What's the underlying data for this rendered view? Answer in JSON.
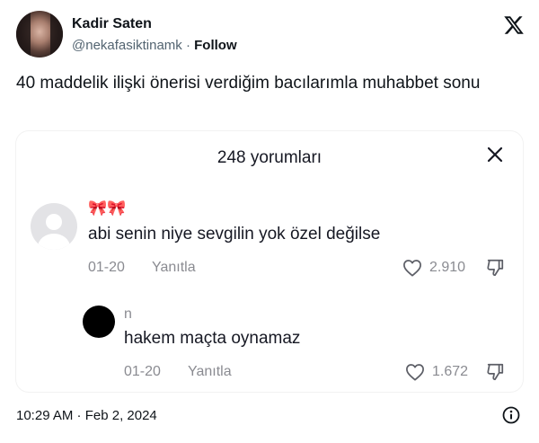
{
  "tweet": {
    "author": {
      "display_name": "Kadir Saten",
      "handle": "@nekafasiktinamk",
      "separator": "·",
      "follow_label": "Follow"
    },
    "text": "40 maddelik ilişki önerisi verdiğim bacılarımla muhabbet sonu",
    "timestamp": "10:29 AM · Feb 2, 2024"
  },
  "comments_panel": {
    "title": "248 yorumları",
    "comments": [
      {
        "username": "🎀🎀",
        "text": "abi senin niye sevgilin yok özel değilse",
        "date": "01-20",
        "reply_label": "Yanıtla",
        "likes": "2.910"
      },
      {
        "username": "n",
        "text": "hakem maçta oynamaz",
        "date": "01-20",
        "reply_label": "Yanıtla",
        "likes": "1.672"
      }
    ]
  },
  "icons": {
    "brand": "x-logo-icon",
    "close": "close-icon",
    "like": "heart-icon",
    "dislike": "thumbs-down-icon",
    "info": "info-icon"
  }
}
